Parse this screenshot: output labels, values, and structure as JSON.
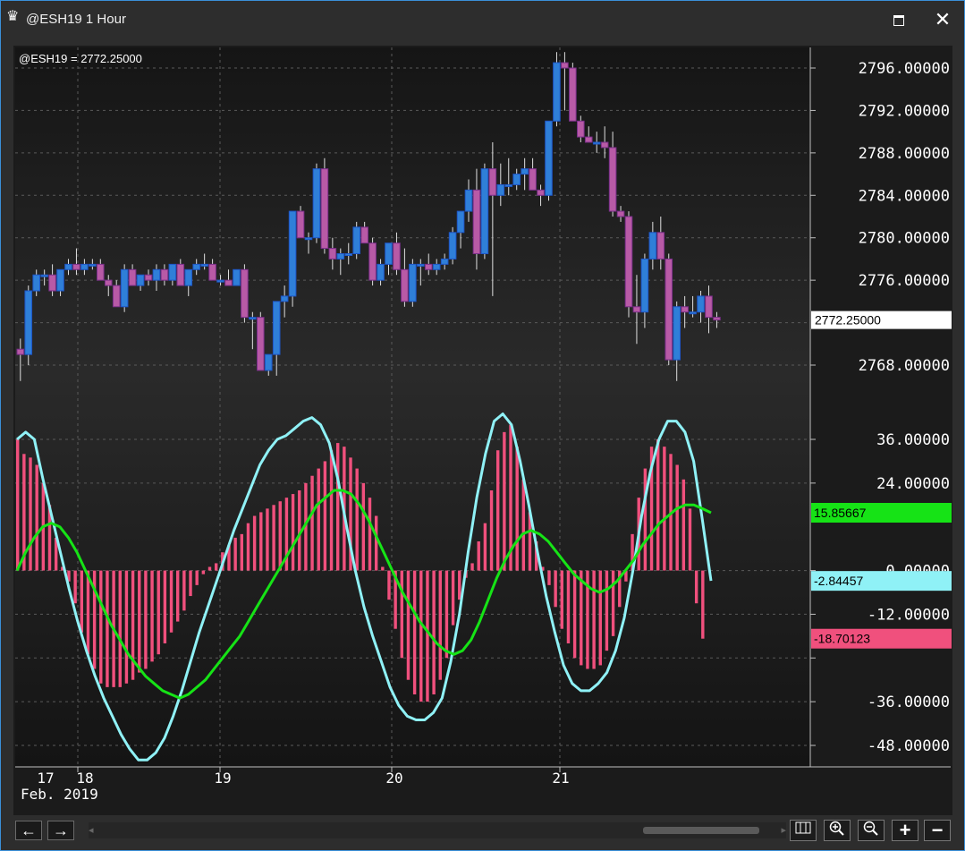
{
  "window": {
    "title": "@ESH19 1 Hour"
  },
  "chart_header": {
    "symbol_readout": "@ESH19 = 2772.25000"
  },
  "price_axis": {
    "ticks": [
      "2796.00000",
      "2792.00000",
      "2788.00000",
      "2784.00000",
      "2780.00000",
      "2776.00000",
      "2768.00000"
    ],
    "tick_values": [
      2796,
      2792,
      2788,
      2784,
      2780,
      2776,
      2768
    ],
    "current_label": "2772.25000",
    "current_value": 2772.25
  },
  "osc_axis": {
    "ticks": [
      "36.00000",
      "24.00000",
      "0.00000",
      "-12.00000",
      "-36.00000",
      "-48.00000"
    ],
    "tick_values": [
      36,
      24,
      0,
      -12,
      -36,
      -48
    ],
    "badges": [
      {
        "label": "15.85667",
        "value": 15.85667,
        "color": "#16e316"
      },
      {
        "label": "-2.84457",
        "value": -2.84457,
        "color": "#8ff1f6"
      },
      {
        "label": "-18.70123",
        "value": -18.70123,
        "color": "#f0507d"
      }
    ]
  },
  "time_axis": {
    "labels": [
      "17",
      "18",
      "19",
      "20",
      "21"
    ],
    "month_label": "Feb. 2019"
  },
  "colors": {
    "up_candle": "#2f7fd8",
    "down_candle": "#b85aa6",
    "histogram": "#f0507d",
    "fast_line": "#8ff1f6",
    "slow_line": "#16e316",
    "background": "#1b1b1b"
  },
  "chart_data": [
    {
      "type": "candlestick",
      "title": "@ESH19 1 Hour",
      "ylim": [
        2764,
        2798
      ],
      "candles": [
        [
          2769.5,
          2770.5,
          2766.5,
          2769.0
        ],
        [
          2769.0,
          2775.5,
          2768.0,
          2775.0
        ],
        [
          2775.0,
          2777.0,
          2774.5,
          2776.5
        ],
        [
          2776.5,
          2777.0,
          2775.5,
          2776.5
        ],
        [
          2776.5,
          2777.5,
          2774.5,
          2775.0
        ],
        [
          2775.0,
          2777.0,
          2774.5,
          2777.0
        ],
        [
          2777.0,
          2778.0,
          2776.5,
          2777.5
        ],
        [
          2777.5,
          2779.0,
          2776.5,
          2777.0
        ],
        [
          2777.0,
          2778.0,
          2776.5,
          2777.5
        ],
        [
          2777.5,
          2778.0,
          2777.0,
          2777.5
        ],
        [
          2777.5,
          2778.0,
          2776.0,
          2776.0
        ],
        [
          2776.0,
          2776.5,
          2774.5,
          2775.5
        ],
        [
          2775.5,
          2776.0,
          2773.5,
          2773.5
        ],
        [
          2773.5,
          2777.5,
          2773.0,
          2777.0
        ],
        [
          2777.0,
          2777.5,
          2775.5,
          2775.5
        ],
        [
          2775.5,
          2776.5,
          2775.0,
          2776.5
        ],
        [
          2776.5,
          2777.0,
          2775.5,
          2776.0
        ],
        [
          2776.0,
          2777.5,
          2775.0,
          2777.0
        ],
        [
          2777.0,
          2777.5,
          2775.5,
          2776.0
        ],
        [
          2776.0,
          2777.5,
          2775.5,
          2777.5
        ],
        [
          2777.5,
          2778.0,
          2775.5,
          2775.5
        ],
        [
          2775.5,
          2777.0,
          2774.5,
          2777.0
        ],
        [
          2777.0,
          2778.0,
          2776.5,
          2777.5
        ],
        [
          2777.5,
          2778.5,
          2777.0,
          2777.5
        ],
        [
          2777.5,
          2778.0,
          2776.0,
          2776.0
        ],
        [
          2776.0,
          2776.5,
          2775.5,
          2776.0
        ],
        [
          2776.0,
          2777.0,
          2775.5,
          2775.5
        ],
        [
          2775.5,
          2777.0,
          2775.5,
          2777.0
        ],
        [
          2777.0,
          2777.5,
          2772.0,
          2772.5
        ],
        [
          2772.5,
          2773.0,
          2769.5,
          2772.5
        ],
        [
          2772.5,
          2773.0,
          2767.5,
          2767.5
        ],
        [
          2767.5,
          2769.0,
          2767.0,
          2769.0
        ],
        [
          2769.0,
          2774.0,
          2767.0,
          2774.0
        ],
        [
          2774.0,
          2775.5,
          2772.5,
          2774.5
        ],
        [
          2774.5,
          2782.5,
          2773.5,
          2782.5
        ],
        [
          2782.5,
          2783.0,
          2780.5,
          2780.0
        ],
        [
          2780.0,
          2780.5,
          2778.5,
          2780.0
        ],
        [
          2780.0,
          2787.0,
          2779.5,
          2786.5
        ],
        [
          2786.5,
          2787.5,
          2778.5,
          2779.0
        ],
        [
          2779.0,
          2780.0,
          2777.0,
          2778.0
        ],
        [
          2778.0,
          2779.0,
          2776.5,
          2778.5
        ],
        [
          2778.5,
          2779.5,
          2777.5,
          2778.5
        ],
        [
          2778.5,
          2781.5,
          2778.0,
          2781.0
        ],
        [
          2781.0,
          2781.5,
          2779.5,
          2779.5
        ],
        [
          2779.5,
          2780.0,
          2775.5,
          2776.0
        ],
        [
          2776.0,
          2778.0,
          2775.5,
          2777.5
        ],
        [
          2777.5,
          2779.5,
          2776.5,
          2779.5
        ],
        [
          2779.5,
          2780.5,
          2776.5,
          2777.0
        ],
        [
          2777.0,
          2779.0,
          2773.5,
          2774.0
        ],
        [
          2774.0,
          2778.0,
          2773.5,
          2777.5
        ],
        [
          2777.5,
          2778.0,
          2775.5,
          2777.5
        ],
        [
          2777.5,
          2778.5,
          2776.5,
          2777.0
        ],
        [
          2777.0,
          2778.0,
          2776.5,
          2777.5
        ],
        [
          2777.5,
          2778.5,
          2777.0,
          2778.0
        ],
        [
          2778.0,
          2781.0,
          2777.5,
          2780.5
        ],
        [
          2780.5,
          2782.5,
          2779.0,
          2782.5
        ],
        [
          2782.5,
          2785.5,
          2781.5,
          2784.5
        ],
        [
          2784.5,
          2786.5,
          2777.0,
          2778.5
        ],
        [
          2778.5,
          2787.0,
          2778.0,
          2786.5
        ],
        [
          2786.5,
          2789.0,
          2774.5,
          2784.0
        ],
        [
          2784.0,
          2787.0,
          2783.0,
          2785.0
        ],
        [
          2785.0,
          2787.5,
          2784.0,
          2785.0
        ],
        [
          2785.0,
          2786.5,
          2784.5,
          2786.0
        ],
        [
          2786.0,
          2787.5,
          2784.5,
          2786.5
        ],
        [
          2786.5,
          2787.5,
          2784.5,
          2784.5
        ],
        [
          2784.5,
          2785.0,
          2783.0,
          2784.0
        ],
        [
          2784.0,
          2791.0,
          2783.5,
          2791.0
        ],
        [
          2791.0,
          2797.5,
          2790.5,
          2796.5
        ],
        [
          2796.5,
          2797.5,
          2792.0,
          2796.0
        ],
        [
          2796.0,
          2796.5,
          2791.0,
          2791.0
        ],
        [
          2791.0,
          2791.5,
          2789.0,
          2789.5
        ],
        [
          2789.5,
          2790.5,
          2789.0,
          2789.0
        ],
        [
          2789.0,
          2790.0,
          2788.0,
          2789.0
        ],
        [
          2789.0,
          2790.5,
          2787.5,
          2788.5
        ],
        [
          2788.5,
          2790.0,
          2782.0,
          2782.5
        ],
        [
          2782.5,
          2783.0,
          2781.5,
          2782.0
        ],
        [
          2782.0,
          2782.5,
          2772.5,
          2773.5
        ],
        [
          2773.5,
          2776.5,
          2770.0,
          2773.0
        ],
        [
          2773.0,
          2778.5,
          2771.5,
          2778.0
        ],
        [
          2778.0,
          2781.5,
          2777.0,
          2780.5
        ],
        [
          2780.5,
          2782.0,
          2777.0,
          2778.0
        ],
        [
          2778.0,
          2778.5,
          2768.0,
          2768.5
        ],
        [
          2768.5,
          2774.0,
          2766.5,
          2773.5
        ],
        [
          2773.5,
          2774.5,
          2771.5,
          2773.0
        ],
        [
          2773.0,
          2774.5,
          2772.5,
          2773.0
        ],
        [
          2773.0,
          2775.0,
          2772.0,
          2774.5
        ],
        [
          2774.5,
          2775.5,
          2771.0,
          2772.5
        ],
        [
          2772.5,
          2773.0,
          2771.5,
          2772.25
        ]
      ]
    },
    {
      "type": "bar",
      "series": [
        {
          "values": [
            36,
            32,
            31,
            29,
            24,
            18,
            9,
            1,
            -3,
            -9,
            -17,
            -23,
            -27,
            -31,
            -32,
            -32,
            -32,
            -31,
            -30,
            -28,
            -27,
            -25,
            -23,
            -20,
            -17,
            -14,
            -11,
            -7,
            -4,
            -1,
            1,
            2,
            5,
            7,
            9,
            10,
            13,
            15,
            16,
            17,
            18,
            19,
            20,
            21,
            22,
            24,
            26,
            28,
            30,
            33,
            35,
            34,
            31,
            28,
            24,
            20,
            15,
            1,
            -8,
            -16,
            -24,
            -30,
            -34,
            -36,
            -36,
            -34,
            -30,
            -24,
            -15,
            -8,
            -2,
            2,
            8,
            13,
            22,
            33,
            38,
            40,
            34,
            25,
            16,
            8,
            1,
            -4,
            -10,
            -16,
            -20,
            -24,
            -26,
            -27,
            -27,
            -26,
            -22,
            -18,
            -10,
            -3,
            10,
            20,
            28,
            34,
            36,
            34,
            32,
            29,
            25,
            17,
            -9,
            -18.7
          ]
        }
      ],
      "ylim": [
        -52,
        42
      ]
    },
    {
      "type": "line",
      "series": [
        {
          "values": [
            36,
            38,
            36,
            25,
            15,
            5,
            -5,
            -14,
            -22,
            -29,
            -35,
            -40,
            -45,
            -49,
            -52,
            -52,
            -50,
            -46,
            -40,
            -33,
            -25,
            -17,
            -10,
            -3,
            4,
            11,
            17,
            23,
            29,
            33,
            36,
            37,
            39,
            41,
            42,
            40,
            35,
            25,
            12,
            0,
            -10,
            -18,
            -25,
            -32,
            -37,
            -40,
            -41,
            -41,
            -39,
            -35,
            -25,
            -12,
            5,
            20,
            32,
            41,
            43,
            40,
            30,
            18,
            5,
            -7,
            -17,
            -26,
            -31,
            -33,
            -33,
            -31,
            -28,
            -22,
            -13,
            0,
            15,
            27,
            36,
            41,
            41,
            38,
            30,
            14,
            -2.84
          ]
        },
        {
          "values": [
            0,
            5,
            9,
            12,
            13,
            12,
            9,
            5,
            0,
            -5,
            -10,
            -15,
            -19,
            -23,
            -26,
            -29,
            -31,
            -33,
            -34,
            -35,
            -34,
            -32,
            -30,
            -27,
            -24,
            -21,
            -18,
            -14,
            -10,
            -6,
            -2,
            2,
            6,
            10,
            14,
            18,
            20,
            22,
            22,
            21,
            18,
            14,
            9,
            4,
            -1,
            -6,
            -10,
            -14,
            -17,
            -20,
            -22,
            -23,
            -22,
            -19,
            -14,
            -8,
            -2,
            3,
            7,
            10,
            11,
            10,
            8,
            5,
            2,
            -1,
            -3,
            -5,
            -6,
            -5,
            -3,
            0,
            3,
            7,
            10,
            13,
            15,
            17,
            18,
            18,
            17,
            15.86
          ]
        }
      ],
      "ylim": [
        -52,
        42
      ]
    }
  ]
}
